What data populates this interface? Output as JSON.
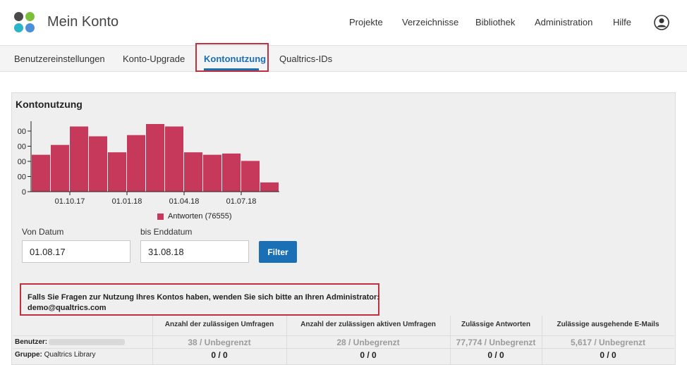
{
  "header": {
    "title": "Mein Konto",
    "logo_colors": [
      "#4a4a4a",
      "#7bbf3a",
      "#2bb5c8",
      "#4a8fd8"
    ],
    "nav": [
      "Projekte",
      "Verzeichnisse",
      "Bibliothek",
      "Administration",
      "Hilfe"
    ]
  },
  "tabs": {
    "items": [
      "Benutzereinstellungen",
      "Konto-Upgrade",
      "Kontonutzung",
      "Qualtrics-IDs"
    ],
    "active": "Kontonutzung"
  },
  "panel": {
    "title": "Kontonutzung"
  },
  "chart_data": {
    "type": "bar",
    "series": [
      {
        "name": "Antworten (76555)",
        "color": "#c7395b",
        "values": [
          3000,
          3800,
          5300,
          4500,
          3200,
          4600,
          5500,
          5300,
          3200,
          3000,
          3100,
          2500,
          750
        ]
      }
    ],
    "xtick_labels": [
      "01.10.17",
      "01.01.18",
      "01.04.18",
      "01.07.18"
    ],
    "ytick_labels": [
      "0",
      "00",
      "00",
      "00",
      "00"
    ],
    "ylim": [
      0,
      5500
    ],
    "legend": "bottom"
  },
  "filter": {
    "from_label": "Von Datum",
    "from_value": "01.08.17",
    "to_label": "bis Enddatum",
    "to_value": "31.08.18",
    "button": "Filter"
  },
  "notice": {
    "text": "Falls Sie Fragen zur Nutzung Ihres Kontos haben, wenden Sie sich bitte an Ihren Administrator:",
    "email": "demo@qualtrics.com"
  },
  "table": {
    "headers": [
      "Anzahl der zulässigen Umfragen",
      "Anzahl der zulässigen aktiven Umfragen",
      "Zulässige Antworten",
      "Zulässige ausgehende E-Mails"
    ],
    "rows": [
      {
        "label": "Benutzer:",
        "name": "",
        "values": [
          "38 / Unbegrenzt",
          "28 / Unbegrenzt",
          "77,774 / Unbegrenzt",
          "5,617 / Unbegrenzt"
        ]
      },
      {
        "label": "Gruppe:",
        "name": "Qualtrics Library",
        "values": [
          "0 / 0",
          "0 / 0",
          "0 / 0",
          "0 / 0"
        ]
      }
    ]
  }
}
